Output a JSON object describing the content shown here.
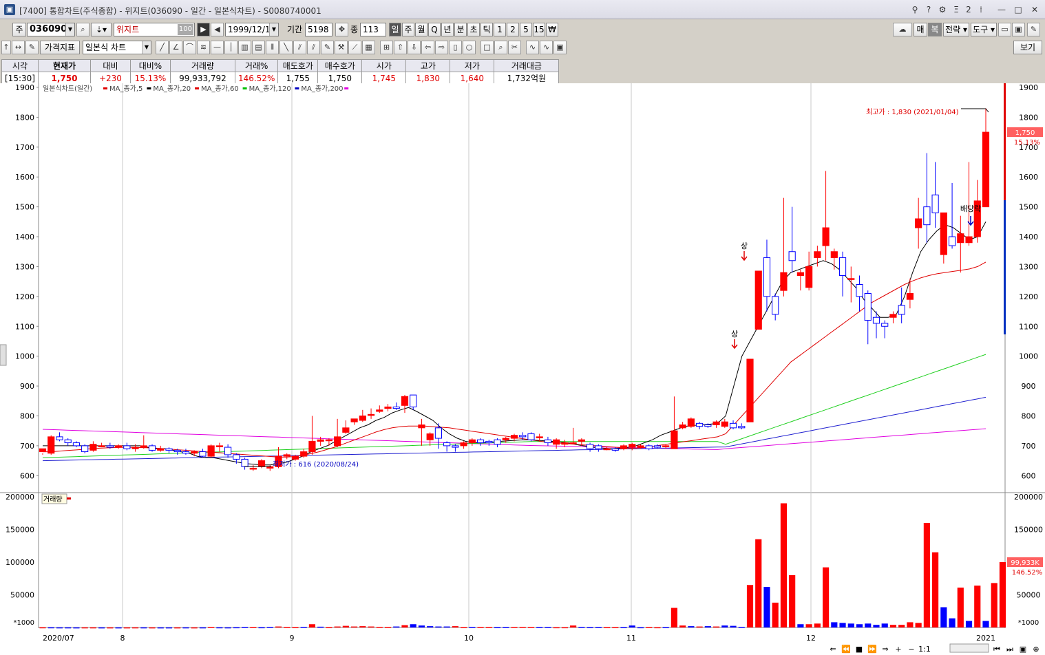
{
  "window": {
    "title": "[7400] 통합차트(주식종합) - 위지트(036090 - 일간 - 일본식차트) - S0080740001",
    "controls": [
      "?",
      "Ξ",
      "2",
      "—",
      "□",
      "✕"
    ]
  },
  "toolbar": {
    "market": "주",
    "code": "036090",
    "name": "위지트",
    "name_badge": "100",
    "date": "1999/12/10",
    "period_label": "기간",
    "period_value": "5198",
    "count_label": "종",
    "count_value": "113",
    "intervals": [
      "일",
      "주",
      "월",
      "Q",
      "년",
      "분",
      "초",
      "틱",
      "1",
      "2",
      "5",
      "15",
      "₩"
    ],
    "selected_interval": "일",
    "right_buttons": [
      "매",
      "복",
      "전략",
      "도구"
    ],
    "indicator_button": "가격지표",
    "chart_type": "일본식 차트",
    "view_button": "보기"
  },
  "quote": {
    "headers": [
      "시각",
      "현재가",
      "대비",
      "대비%",
      "거래량",
      "거래%",
      "매도호가",
      "매수호가",
      "시가",
      "고가",
      "저가",
      "거래대금"
    ],
    "values": [
      "[15:30]",
      "1,750",
      "+230",
      "15.13%",
      "99,933,792",
      "146.52%",
      "1,755",
      "1,750",
      "1,745",
      "1,830",
      "1,640",
      "1,732억원"
    ]
  },
  "legend": {
    "title": "일본식차트(일간)",
    "items": [
      {
        "label": "MA_종가,5",
        "color": "#e00000"
      },
      {
        "label": "MA_종가,20",
        "color": "#000000"
      },
      {
        "label": "MA_종가,60",
        "color": "#e00000"
      },
      {
        "label": "MA_종가,120",
        "color": "#00c000"
      },
      {
        "label": "MA_종가,200",
        "color": "#0000c0"
      }
    ],
    "last_color": "#e000e0",
    "volume_label": "거래량"
  },
  "annotations": {
    "high": "최고가 : 1,830 (2021/01/04)",
    "low": "최저가 : 616 (2020/08/24)",
    "limit_up": "상",
    "dividend": "배당락",
    "price_tag": "1,750",
    "pct_tag": "15.13%",
    "vol_tag": "99,933K",
    "vol_pct_tag": "146.52%",
    "vol_unit": "*1000"
  },
  "colors": {
    "up": "#ff0000",
    "down": "#0000ff",
    "up_vol": "#ff0000",
    "down_vol": "#0000ff"
  },
  "chart_data": {
    "type": "candlestick",
    "title": "일본식차트(일간)",
    "price_axis": {
      "min": 550,
      "max": 1900,
      "ticks": [
        600,
        700,
        800,
        900,
        1000,
        1100,
        1200,
        1300,
        1400,
        1500,
        1600,
        1700,
        1800,
        1900
      ]
    },
    "volume_axis": {
      "min": 0,
      "max": 200000,
      "ticks": [
        50000,
        100000,
        150000,
        200000
      ],
      "unit": "*1000"
    },
    "x_labels": [
      "2020/07",
      "8",
      "9",
      "10",
      "11",
      "12",
      "2021"
    ],
    "candles": [
      [
        680,
        690,
        675,
        670
      ],
      [
        675,
        730,
        735,
        670
      ],
      [
        730,
        720,
        745,
        715
      ],
      [
        720,
        710,
        725,
        700
      ],
      [
        710,
        700,
        715,
        695
      ],
      [
        700,
        680,
        705,
        675
      ],
      [
        685,
        705,
        715,
        680
      ],
      [
        700,
        700,
        710,
        695
      ],
      [
        700,
        695,
        710,
        690
      ],
      [
        695,
        700,
        705,
        690
      ],
      [
        700,
        690,
        710,
        685
      ],
      [
        690,
        695,
        705,
        680
      ],
      [
        695,
        700,
        735,
        690
      ],
      [
        700,
        685,
        705,
        680
      ],
      [
        685,
        690,
        700,
        680
      ],
      [
        690,
        685,
        695,
        675
      ],
      [
        685,
        680,
        690,
        670
      ],
      [
        680,
        675,
        690,
        670
      ],
      [
        675,
        680,
        685,
        665
      ],
      [
        680,
        665,
        690,
        660
      ],
      [
        665,
        700,
        705,
        660
      ],
      [
        700,
        700,
        710,
        680
      ],
      [
        695,
        670,
        705,
        660
      ],
      [
        670,
        655,
        675,
        640
      ],
      [
        655,
        630,
        660,
        620
      ],
      [
        625,
        625,
        635,
        616
      ],
      [
        630,
        650,
        655,
        625
      ],
      [
        625,
        630,
        635,
        616
      ],
      [
        630,
        665,
        695,
        625
      ],
      [
        665,
        670,
        675,
        655
      ],
      [
        655,
        665,
        670,
        650
      ],
      [
        665,
        680,
        690,
        660
      ],
      [
        680,
        715,
        800,
        670
      ],
      [
        715,
        720,
        730,
        700
      ],
      [
        720,
        720,
        725,
        700
      ],
      [
        700,
        730,
        790,
        695
      ],
      [
        745,
        760,
        785,
        740
      ],
      [
        780,
        790,
        790,
        770
      ],
      [
        785,
        800,
        820,
        780
      ],
      [
        805,
        805,
        825,
        790
      ],
      [
        815,
        820,
        835,
        810
      ],
      [
        825,
        830,
        840,
        815
      ],
      [
        830,
        825,
        845,
        820
      ],
      [
        835,
        865,
        870,
        810
      ],
      [
        870,
        830,
        870,
        820
      ],
      [
        760,
        770,
        790,
        700
      ],
      [
        720,
        740,
        745,
        700
      ],
      [
        760,
        725,
        775,
        690
      ],
      [
        710,
        700,
        715,
        680
      ],
      [
        700,
        695,
        705,
        680
      ],
      [
        700,
        710,
        715,
        690
      ],
      [
        710,
        720,
        725,
        700
      ],
      [
        720,
        710,
        725,
        700
      ],
      [
        715,
        710,
        720,
        700
      ],
      [
        720,
        705,
        725,
        695
      ],
      [
        720,
        725,
        730,
        710
      ],
      [
        725,
        735,
        740,
        715
      ],
      [
        735,
        730,
        745,
        720
      ],
      [
        740,
        720,
        745,
        715
      ],
      [
        730,
        730,
        740,
        715
      ],
      [
        720,
        710,
        730,
        700
      ],
      [
        705,
        720,
        725,
        690
      ],
      [
        705,
        710,
        720,
        695
      ],
      [
        710,
        710,
        760,
        705
      ],
      [
        715,
        720,
        725,
        700
      ],
      [
        705,
        690,
        710,
        680
      ],
      [
        700,
        690,
        705,
        680
      ],
      [
        690,
        690,
        695,
        685
      ],
      [
        690,
        685,
        695,
        680
      ],
      [
        690,
        700,
        705,
        685
      ],
      [
        695,
        705,
        710,
        685
      ],
      [
        695,
        700,
        705,
        690
      ],
      [
        700,
        690,
        705,
        685
      ],
      [
        700,
        695,
        705,
        690
      ],
      [
        700,
        700,
        705,
        690
      ],
      [
        690,
        750,
        865,
        690
      ],
      [
        760,
        770,
        780,
        755
      ],
      [
        765,
        790,
        795,
        760
      ],
      [
        775,
        765,
        780,
        755
      ],
      [
        770,
        765,
        775,
        760
      ],
      [
        770,
        780,
        785,
        760
      ],
      [
        765,
        780,
        790,
        760
      ],
      [
        775,
        760,
        785,
        755
      ],
      [
        765,
        760,
        775,
        755
      ],
      [
        780,
        990,
        990,
        780
      ],
      [
        1090,
        1285,
        1285,
        1090
      ],
      [
        1330,
        1200,
        1390,
        1150
      ],
      [
        1200,
        1140,
        1210,
        1120
      ],
      [
        1220,
        1280,
        1530,
        1200
      ],
      [
        1350,
        1320,
        1500,
        1280
      ],
      [
        1270,
        1280,
        1290,
        1220
      ],
      [
        1230,
        1300,
        1350,
        1220
      ],
      [
        1330,
        1350,
        1370,
        1300
      ],
      [
        1370,
        1430,
        1620,
        1320
      ],
      [
        1330,
        1350,
        1360,
        1290
      ],
      [
        1330,
        1270,
        1350,
        1200
      ],
      [
        1260,
        1260,
        1300,
        1180
      ],
      [
        1240,
        1200,
        1270,
        1150
      ],
      [
        1210,
        1120,
        1220,
        1040
      ],
      [
        1130,
        1110,
        1150,
        1060
      ],
      [
        1110,
        1100,
        1120,
        1060
      ],
      [
        1130,
        1140,
        1150,
        1110
      ],
      [
        1170,
        1140,
        1230,
        1110
      ],
      [
        1190,
        1210,
        1260,
        1160
      ],
      [
        1430,
        1460,
        1530,
        1360
      ],
      [
        1500,
        1440,
        1680,
        1380
      ],
      [
        1540,
        1480,
        1650,
        1430
      ],
      [
        1340,
        1480,
        1480,
        1310
      ],
      [
        1400,
        1370,
        1580,
        1360
      ],
      [
        1380,
        1410,
        1470,
        1280
      ],
      [
        1380,
        1400,
        1650,
        1370
      ],
      [
        1400,
        1520,
        1590,
        1380
      ],
      [
        1500,
        1750,
        1830,
        1640
      ]
    ],
    "volumes": [
      [
        300,
        "up"
      ],
      [
        300,
        "down"
      ],
      [
        200,
        "down"
      ],
      [
        200,
        "down"
      ],
      [
        150,
        "down"
      ],
      [
        200,
        "up"
      ],
      [
        200,
        "up"
      ],
      [
        150,
        "down"
      ],
      [
        150,
        "up"
      ],
      [
        150,
        "down"
      ],
      [
        150,
        "up"
      ],
      [
        200,
        "up"
      ],
      [
        200,
        "down"
      ],
      [
        150,
        "up"
      ],
      [
        150,
        "down"
      ],
      [
        150,
        "down"
      ],
      [
        150,
        "up"
      ],
      [
        200,
        "down"
      ],
      [
        150,
        "up"
      ],
      [
        200,
        "down"
      ],
      [
        800,
        "up"
      ],
      [
        300,
        "down"
      ],
      [
        200,
        "down"
      ],
      [
        400,
        "down"
      ],
      [
        800,
        "down"
      ],
      [
        600,
        "up"
      ],
      [
        400,
        "down"
      ],
      [
        900,
        "down"
      ],
      [
        1500,
        "up"
      ],
      [
        800,
        "up"
      ],
      [
        500,
        "up"
      ],
      [
        1000,
        "down"
      ],
      [
        5000,
        "up"
      ],
      [
        1200,
        "down"
      ],
      [
        500,
        "up"
      ],
      [
        1500,
        "up"
      ],
      [
        2500,
        "up"
      ],
      [
        1500,
        "up"
      ],
      [
        2000,
        "up"
      ],
      [
        1500,
        "up"
      ],
      [
        1000,
        "up"
      ],
      [
        800,
        "up"
      ],
      [
        1500,
        "down"
      ],
      [
        3500,
        "up"
      ],
      [
        5000,
        "down"
      ],
      [
        3000,
        "down"
      ],
      [
        2000,
        "down"
      ],
      [
        1500,
        "down"
      ],
      [
        1500,
        "down"
      ],
      [
        2000,
        "up"
      ],
      [
        500,
        "up"
      ],
      [
        800,
        "down"
      ],
      [
        800,
        "up"
      ],
      [
        700,
        "up"
      ],
      [
        500,
        "down"
      ],
      [
        600,
        "down"
      ],
      [
        800,
        "up"
      ],
      [
        1000,
        "up"
      ],
      [
        800,
        "up"
      ],
      [
        700,
        "down"
      ],
      [
        800,
        "down"
      ],
      [
        400,
        "up"
      ],
      [
        400,
        "up"
      ],
      [
        3000,
        "up"
      ],
      [
        1000,
        "down"
      ],
      [
        500,
        "down"
      ],
      [
        600,
        "down"
      ],
      [
        500,
        "up"
      ],
      [
        500,
        "up"
      ],
      [
        500,
        "down"
      ],
      [
        3000,
        "down"
      ],
      [
        400,
        "down"
      ],
      [
        600,
        "up"
      ],
      [
        400,
        "up"
      ],
      [
        500,
        "down"
      ],
      [
        30000,
        "up"
      ],
      [
        3000,
        "up"
      ],
      [
        2000,
        "down"
      ],
      [
        1500,
        "up"
      ],
      [
        2000,
        "down"
      ],
      [
        1500,
        "up"
      ],
      [
        3000,
        "down"
      ],
      [
        2500,
        "down"
      ],
      [
        1000,
        "down"
      ],
      [
        65000,
        "up"
      ],
      [
        135000,
        "up"
      ],
      [
        62000,
        "down"
      ],
      [
        38000,
        "up"
      ],
      [
        190000,
        "up"
      ],
      [
        80000,
        "up"
      ],
      [
        5000,
        "down"
      ],
      [
        5000,
        "up"
      ],
      [
        6000,
        "up"
      ],
      [
        92000,
        "up"
      ],
      [
        8000,
        "down"
      ],
      [
        7000,
        "down"
      ],
      [
        6000,
        "down"
      ],
      [
        5000,
        "down"
      ],
      [
        6000,
        "down"
      ],
      [
        4000,
        "down"
      ],
      [
        6000,
        "down"
      ],
      [
        4000,
        "up"
      ],
      [
        4000,
        "up"
      ],
      [
        8000,
        "up"
      ],
      [
        7000,
        "up"
      ],
      [
        160000,
        "up"
      ],
      [
        115000,
        "up"
      ],
      [
        31000,
        "down"
      ],
      [
        14000,
        "down"
      ],
      [
        61000,
        "up"
      ],
      [
        10000,
        "down"
      ],
      [
        64000,
        "up"
      ],
      [
        10000,
        "down"
      ],
      [
        68000,
        "up"
      ],
      [
        100000,
        "up"
      ]
    ],
    "ma5_label": "MA_종가,5",
    "ma20": [
      700,
      700,
      700,
      700,
      700,
      700,
      700,
      700,
      700,
      700,
      700,
      700,
      700,
      695,
      690,
      690,
      685,
      680,
      675,
      665,
      660,
      660,
      655,
      650,
      645,
      640,
      638,
      636,
      636,
      640,
      645,
      655,
      665,
      680,
      690,
      700,
      715,
      730,
      745,
      760,
      770,
      785,
      795,
      810,
      820,
      828,
      815,
      800,
      785,
      760,
      740,
      725,
      715,
      710,
      710,
      712,
      714,
      716,
      718,
      720,
      720,
      718,
      716,
      714,
      712,
      708,
      702,
      698,
      694,
      692,
      690,
      692,
      695,
      700,
      710,
      720,
      735,
      745,
      755,
      765,
      768,
      770,
      772,
      775,
      800,
      900,
      1000,
      1050,
      1100,
      1150,
      1200,
      1250,
      1280,
      1290,
      1300,
      1310,
      1320,
      1310,
      1290,
      1260,
      1230,
      1190,
      1160,
      1130,
      1130,
      1140,
      1200,
      1280,
      1350,
      1390,
      1420,
      1440,
      1430,
      1410,
      1390,
      1400,
      1450
    ],
    "ma60": [
      680,
      680,
      682,
      684,
      686,
      688,
      690,
      692,
      693,
      694,
      695,
      695,
      694,
      693,
      692,
      690,
      688,
      686,
      684,
      682,
      680,
      678,
      676,
      674,
      672,
      670,
      668,
      666,
      664,
      662,
      662,
      664,
      668,
      674,
      680,
      688,
      696,
      706,
      716,
      726,
      736,
      746,
      754,
      760,
      764,
      766,
      766,
      766,
      764,
      762,
      760,
      756,
      752,
      748,
      744,
      740,
      736,
      732,
      728,
      724,
      720,
      716,
      712,
      710,
      708,
      706,
      704,
      702,
      700,
      698,
      696,
      694,
      692,
      692,
      694,
      698,
      702,
      706,
      710,
      714,
      718,
      722,
      726,
      730,
      740,
      770,
      800,
      830,
      860,
      890,
      920,
      950,
      980,
      1000,
      1020,
      1040,
      1060,
      1080,
      1100,
      1120,
      1140,
      1160,
      1180,
      1195,
      1210,
      1225,
      1240,
      1252,
      1262,
      1270,
      1276,
      1280,
      1284,
      1288,
      1292,
      1300,
      1315
    ]
  }
}
